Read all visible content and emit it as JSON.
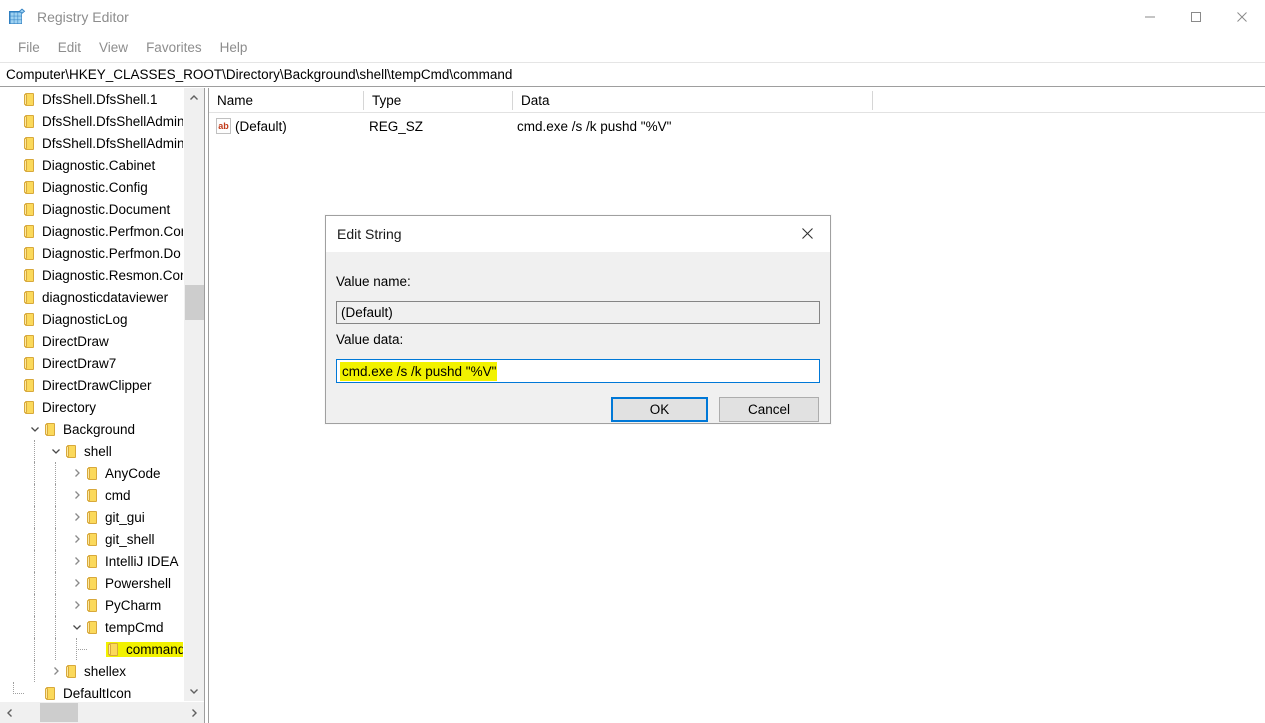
{
  "window": {
    "title": "Registry Editor",
    "app_icon": "registry-grid-icon",
    "minimize_label": "Minimize",
    "maximize_label": "Maximize",
    "close_label": "Close"
  },
  "menubar": {
    "items": [
      {
        "label": "File"
      },
      {
        "label": "Edit"
      },
      {
        "label": "View"
      },
      {
        "label": "Favorites"
      },
      {
        "label": "Help"
      }
    ]
  },
  "address": {
    "path": "Computer\\HKEY_CLASSES_ROOT\\Directory\\Background\\shell\\tempCmd\\command"
  },
  "tree": {
    "items": [
      {
        "label": "DfsShell.DfsShell.1",
        "depth": 0,
        "expander": "none",
        "selected": false
      },
      {
        "label": "DfsShell.DfsShellAdmin",
        "depth": 0,
        "expander": "none",
        "selected": false
      },
      {
        "label": "DfsShell.DfsShellAdmin",
        "depth": 0,
        "expander": "none",
        "selected": false
      },
      {
        "label": "Diagnostic.Cabinet",
        "depth": 0,
        "expander": "none",
        "selected": false
      },
      {
        "label": "Diagnostic.Config",
        "depth": 0,
        "expander": "none",
        "selected": false
      },
      {
        "label": "Diagnostic.Document",
        "depth": 0,
        "expander": "none",
        "selected": false
      },
      {
        "label": "Diagnostic.Perfmon.Cor",
        "depth": 0,
        "expander": "none",
        "selected": false
      },
      {
        "label": "Diagnostic.Perfmon.Do",
        "depth": 0,
        "expander": "none",
        "selected": false
      },
      {
        "label": "Diagnostic.Resmon.Cor",
        "depth": 0,
        "expander": "none",
        "selected": false
      },
      {
        "label": "diagnosticdataviewer",
        "depth": 0,
        "expander": "none",
        "selected": false
      },
      {
        "label": "DiagnosticLog",
        "depth": 0,
        "expander": "none",
        "selected": false
      },
      {
        "label": "DirectDraw",
        "depth": 0,
        "expander": "none",
        "selected": false
      },
      {
        "label": "DirectDraw7",
        "depth": 0,
        "expander": "none",
        "selected": false
      },
      {
        "label": "DirectDrawClipper",
        "depth": 0,
        "expander": "none",
        "selected": false
      },
      {
        "label": "Directory",
        "depth": 0,
        "expander": "none",
        "selected": false
      },
      {
        "label": "Background",
        "depth": 1,
        "expander": "expanded",
        "selected": false
      },
      {
        "label": "shell",
        "depth": 2,
        "expander": "expanded",
        "selected": false
      },
      {
        "label": "AnyCode",
        "depth": 3,
        "expander": "collapsed",
        "selected": false
      },
      {
        "label": "cmd",
        "depth": 3,
        "expander": "collapsed",
        "selected": false
      },
      {
        "label": "git_gui",
        "depth": 3,
        "expander": "collapsed",
        "selected": false
      },
      {
        "label": "git_shell",
        "depth": 3,
        "expander": "collapsed",
        "selected": false
      },
      {
        "label": "IntelliJ IDEA",
        "depth": 3,
        "expander": "collapsed",
        "selected": false
      },
      {
        "label": "Powershell",
        "depth": 3,
        "expander": "collapsed",
        "selected": false
      },
      {
        "label": "PyCharm",
        "depth": 3,
        "expander": "collapsed",
        "selected": false
      },
      {
        "label": "tempCmd",
        "depth": 3,
        "expander": "expanded",
        "selected": false
      },
      {
        "label": "command",
        "depth": 4,
        "expander": "none",
        "selected": true
      },
      {
        "label": "shellex",
        "depth": 2,
        "expander": "collapsed",
        "selected": false
      },
      {
        "label": "DefaultIcon",
        "depth": 1,
        "expander": "none",
        "selected": false
      }
    ],
    "scroll_up_icon": "chevron-up-icon",
    "scroll_down_icon": "chevron-down-icon",
    "scroll_left_icon": "chevron-left-icon",
    "scroll_right_icon": "chevron-right-icon"
  },
  "list": {
    "columns": [
      {
        "label": "Name"
      },
      {
        "label": "Type"
      },
      {
        "label": "Data"
      }
    ],
    "rows": [
      {
        "icon": "string-value-icon",
        "icon_text": "ab",
        "name": "(Default)",
        "type": "REG_SZ",
        "data": "cmd.exe /s /k pushd \"%V\""
      }
    ]
  },
  "dialog": {
    "title": "Edit String",
    "close_icon": "close-icon",
    "value_name_label": "Value name:",
    "value_name": "(Default)",
    "value_data_label": "Value data:",
    "value_data": "cmd.exe /s /k pushd \"%V\"",
    "ok_label": "OK",
    "cancel_label": "Cancel"
  },
  "colors": {
    "highlight_yellow": "#f2f200",
    "focus_blue": "#0078d7",
    "folder_yellow": "#fbd95b",
    "icon_red": "#c13a1a"
  }
}
